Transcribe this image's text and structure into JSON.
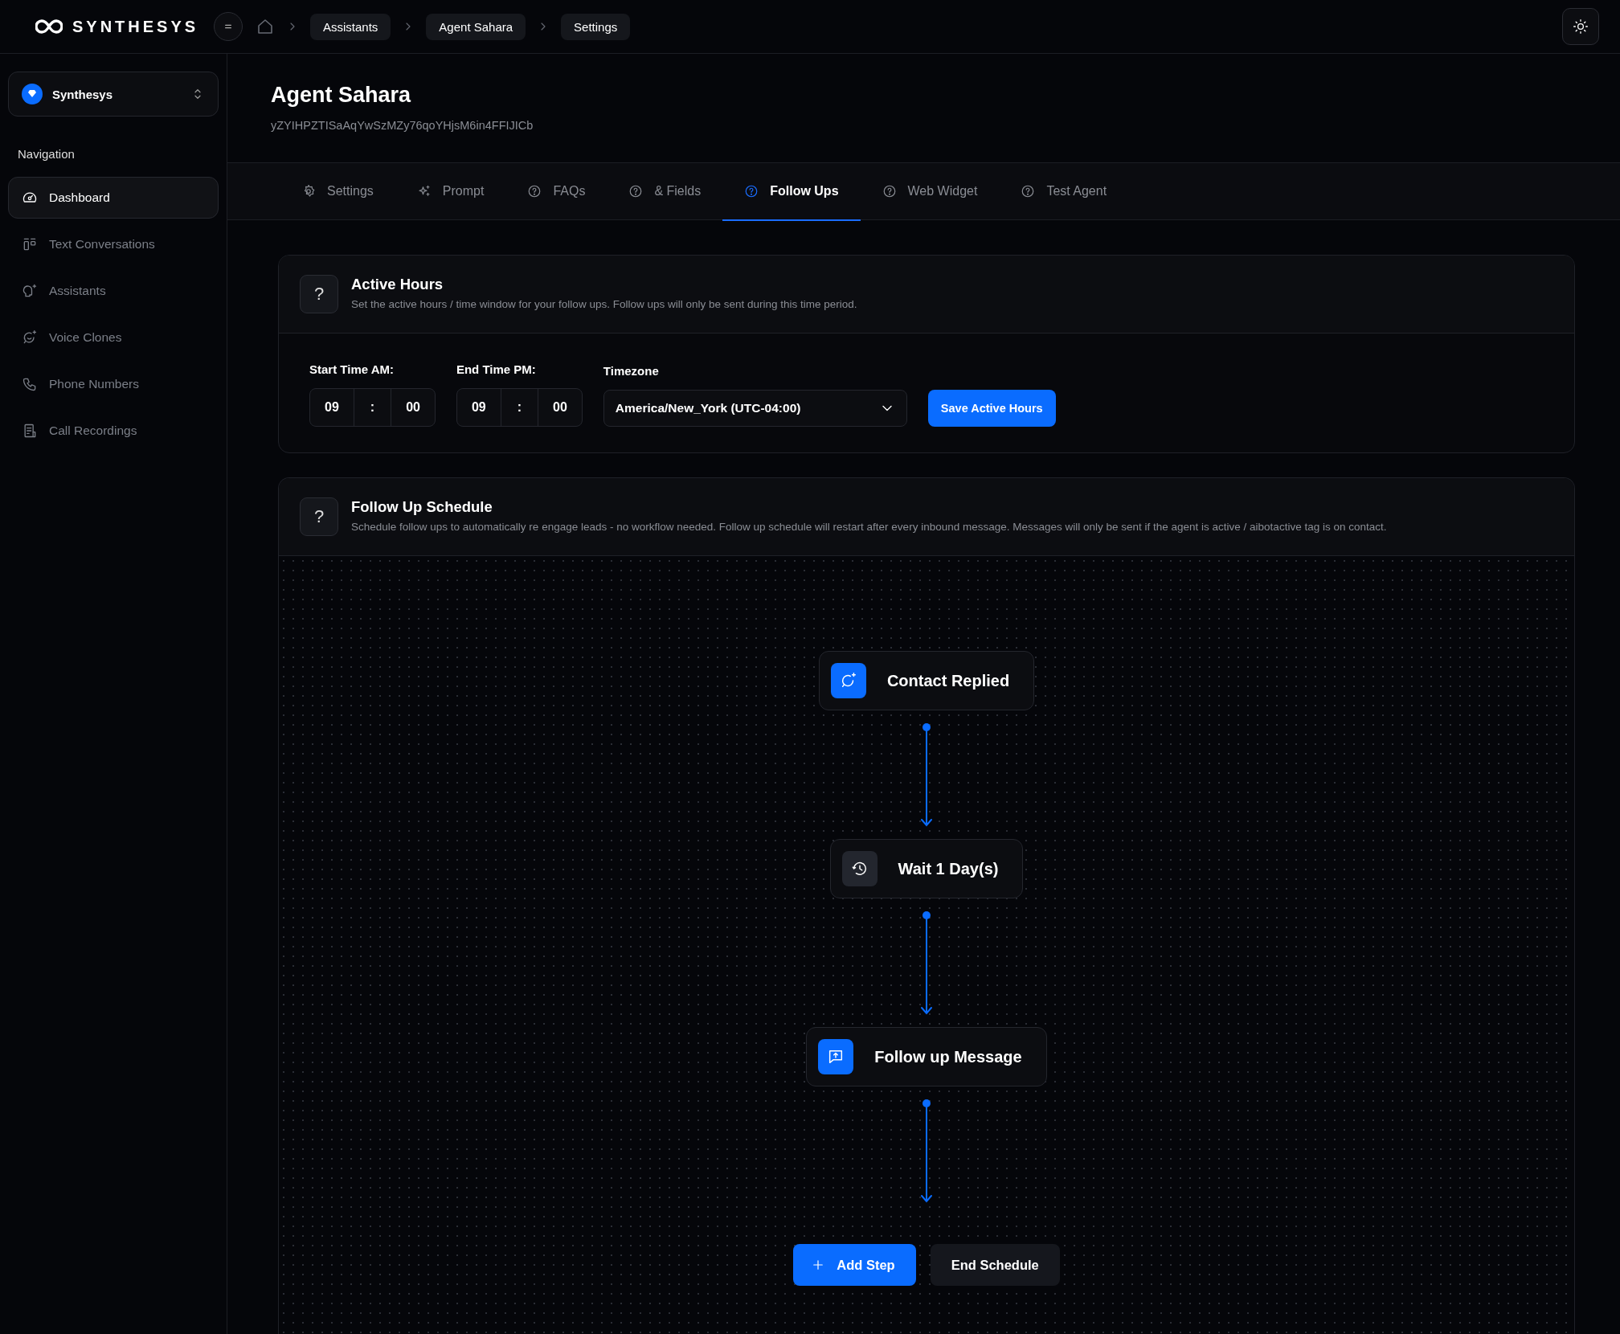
{
  "brand": {
    "name": "SYNTHESYS"
  },
  "breadcrumbs": [
    {
      "label": "Assistants"
    },
    {
      "label": "Agent Sahara"
    },
    {
      "label": "Settings"
    }
  ],
  "workspace": {
    "name": "Synthesys"
  },
  "sidebar": {
    "heading": "Navigation",
    "items": [
      {
        "label": "Dashboard",
        "selected": true
      },
      {
        "label": "Text Conversations",
        "selected": false
      },
      {
        "label": "Assistants",
        "selected": false
      },
      {
        "label": "Voice Clones",
        "selected": false
      },
      {
        "label": "Phone Numbers",
        "selected": false
      },
      {
        "label": "Call Recordings",
        "selected": false
      }
    ]
  },
  "agent": {
    "name": "Agent Sahara",
    "id": "yZYIHPZTISaAqYwSzMZy76qoYHjsM6in4FFIJICb"
  },
  "tabs": [
    {
      "label": "Settings",
      "selected": false
    },
    {
      "label": "Prompt",
      "selected": false
    },
    {
      "label": "FAQs",
      "selected": false
    },
    {
      "label": "& Fields",
      "selected": false
    },
    {
      "label": "Follow Ups",
      "selected": true
    },
    {
      "label": "Web Widget",
      "selected": false
    },
    {
      "label": "Test Agent",
      "selected": false
    }
  ],
  "active_hours": {
    "help": "?",
    "title": "Active Hours",
    "description": "Set the active hours / time window for your follow ups. Follow ups will only be sent during this time period.",
    "start_time": {
      "label": "Start Time AM:",
      "hours": "09",
      "separator": ":",
      "minutes": "00"
    },
    "end_time": {
      "label": "End Time PM:",
      "hours": "09",
      "separator": ":",
      "minutes": "00"
    },
    "timezone": {
      "label": "Timezone",
      "value": "America/New_York (UTC-04:00)"
    },
    "save_button": "Save Active Hours"
  },
  "schedule": {
    "help": "?",
    "title": "Follow Up Schedule",
    "description": "Schedule follow ups to automatically re engage leads - no workflow needed. Follow up schedule will restart after every inbound message. Messages will only be sent if the agent is active / aibotactive tag is on contact.",
    "steps": [
      {
        "kind": "trigger",
        "label": "Contact Replied"
      },
      {
        "kind": "wait",
        "label": "Wait 1 Day(s)"
      },
      {
        "kind": "message",
        "label": "Follow up Message"
      }
    ],
    "add_button": "Add Step",
    "end_button": "End Schedule"
  }
}
